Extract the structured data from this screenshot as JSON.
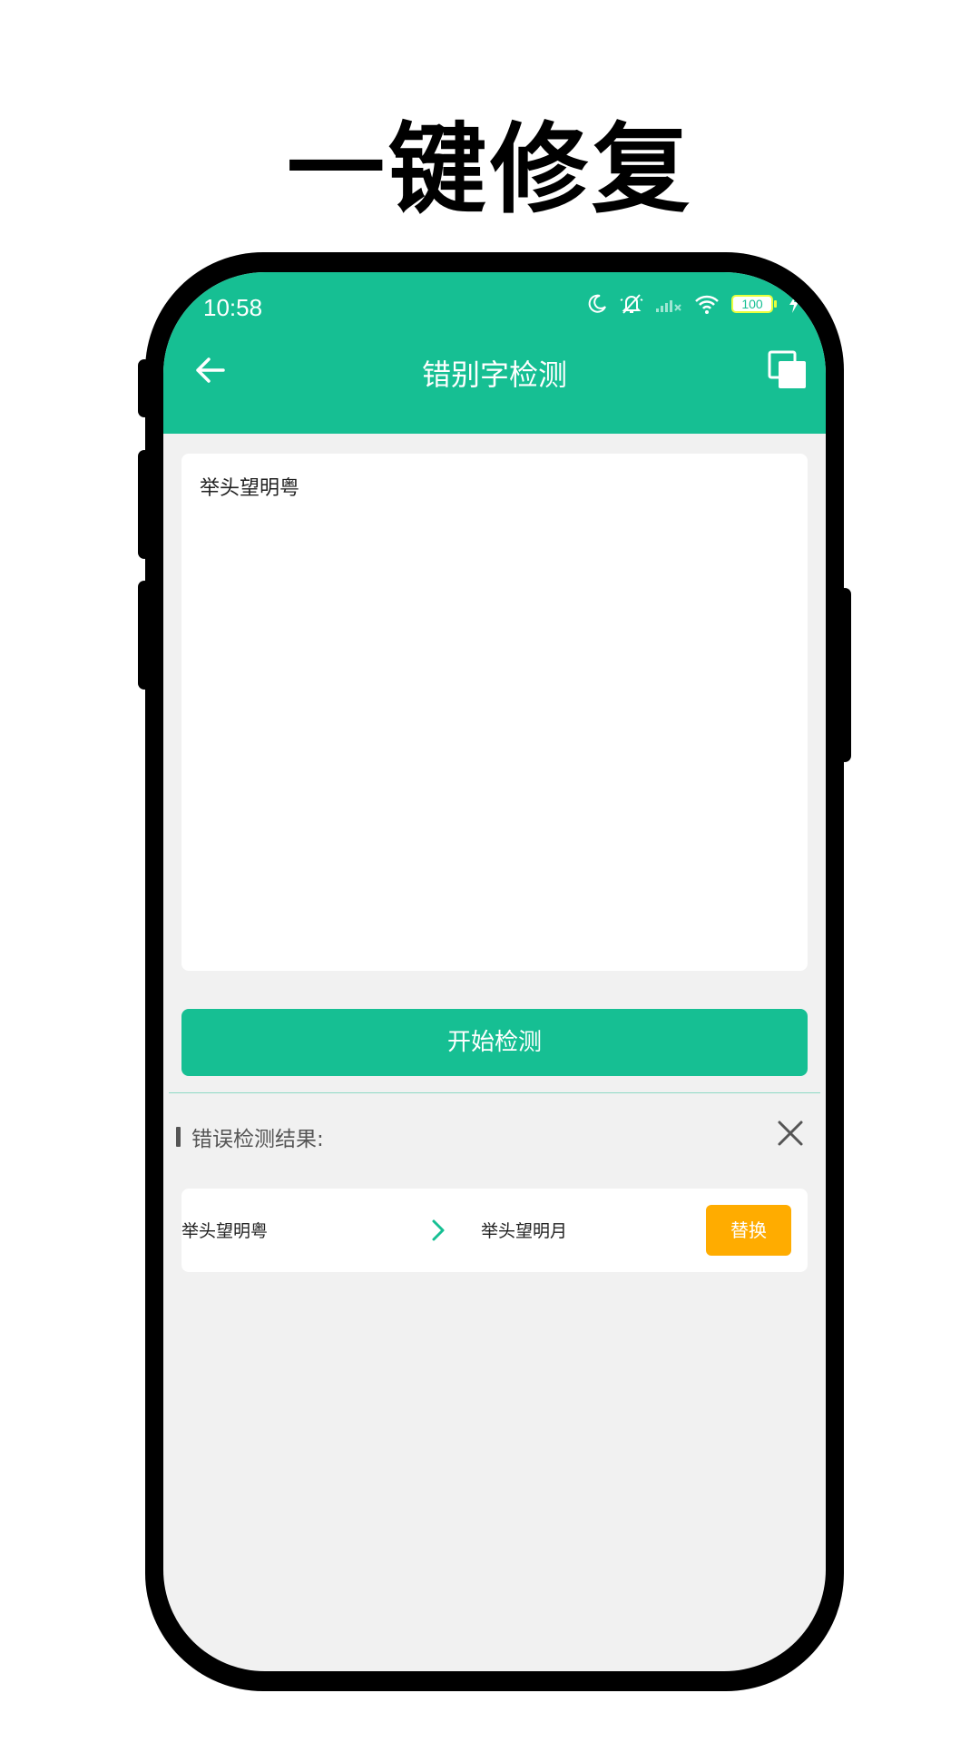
{
  "promo": {
    "title": "一键修复"
  },
  "status_bar": {
    "time": "10:58",
    "battery_level": "100",
    "icons": [
      "moon-icon",
      "bell-off-icon",
      "signal-icon",
      "wifi-icon",
      "battery-icon",
      "charging-icon"
    ]
  },
  "app_bar": {
    "title": "错别字检测",
    "left_icon": "arrow-left-icon",
    "right_icon": "copy-icon"
  },
  "editor": {
    "value": "举头望明粤"
  },
  "actions": {
    "start_label": "开始检测"
  },
  "results": {
    "header_label": "错误检测结果:",
    "close_icon": "close-icon",
    "items": [
      {
        "original": "举头望明粤",
        "corrected": "举头望明月",
        "replace_label": "替换"
      }
    ]
  },
  "colors": {
    "primary": "#16bf93",
    "accent": "#ffac00",
    "background": "#f1f1f1"
  }
}
